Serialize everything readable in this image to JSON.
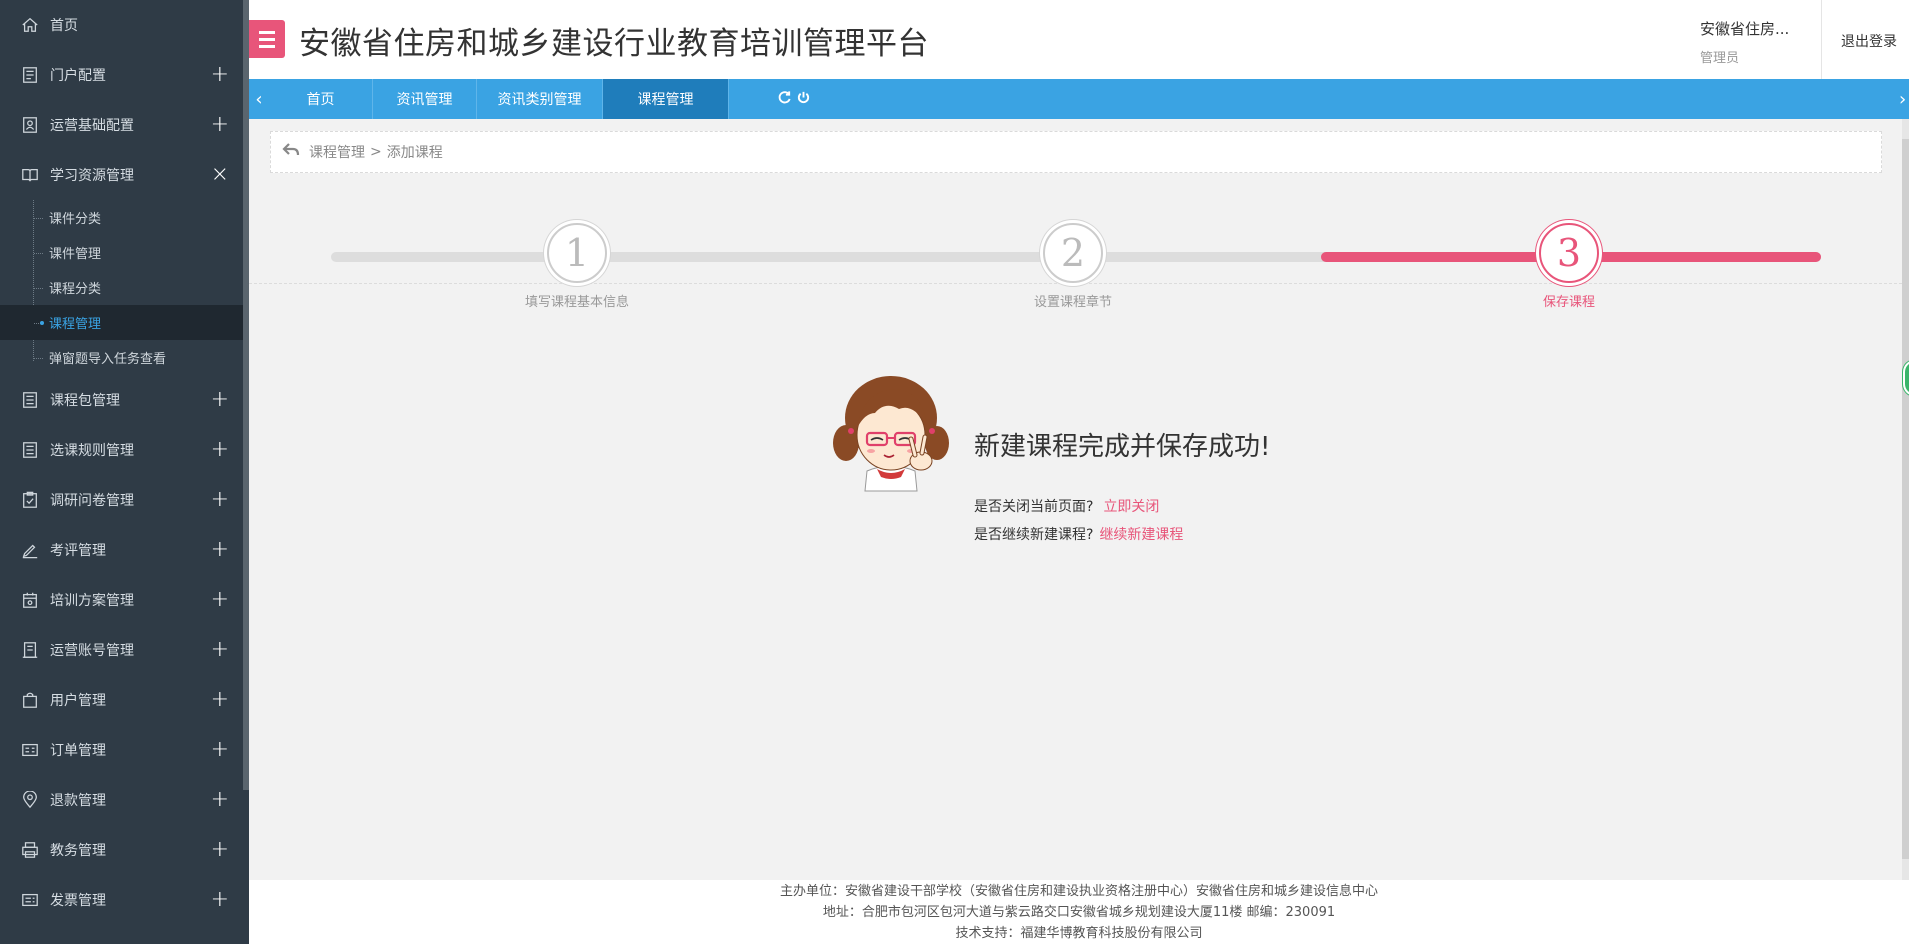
{
  "header": {
    "title": "安徽省住房和城乡建设行业教育培训管理平台",
    "user_name": "安徽省住房...",
    "user_role": "管理员",
    "logout": "退出登录"
  },
  "sidebar": {
    "items": [
      {
        "label": "首页",
        "icon": "home-icon",
        "toggle": ""
      },
      {
        "label": "门户配置",
        "icon": "document-icon",
        "toggle": "+"
      },
      {
        "label": "运营基础配置",
        "icon": "profile-card-icon",
        "toggle": "+"
      },
      {
        "label": "学习资源管理",
        "icon": "book-icon",
        "toggle": "×"
      },
      {
        "label": "课程包管理",
        "icon": "list-icon",
        "toggle": "+"
      },
      {
        "label": "选课规则管理",
        "icon": "list-icon",
        "toggle": "+"
      },
      {
        "label": "调研问卷管理",
        "icon": "clipboard-check-icon",
        "toggle": "+"
      },
      {
        "label": "考评管理",
        "icon": "pen-icon",
        "toggle": "+"
      },
      {
        "label": "培训方案管理",
        "icon": "calendar-icon",
        "toggle": "+"
      },
      {
        "label": "运营账号管理",
        "icon": "account-book-icon",
        "toggle": "+"
      },
      {
        "label": "用户管理",
        "icon": "bag-icon",
        "toggle": "+"
      },
      {
        "label": "订单管理",
        "icon": "order-card-icon",
        "toggle": "+"
      },
      {
        "label": "退款管理",
        "icon": "location-icon",
        "toggle": "+"
      },
      {
        "label": "教务管理",
        "icon": "printer-icon",
        "toggle": "+"
      },
      {
        "label": "发票管理",
        "icon": "invoice-icon",
        "toggle": "+"
      }
    ],
    "sub_items": [
      "课件分类",
      "课件管理",
      "课程分类",
      "课程管理",
      "弹窗题导入任务查看"
    ],
    "active_sub": "课程管理"
  },
  "tabs": [
    {
      "label": "首页",
      "active": false
    },
    {
      "label": "资讯管理",
      "active": false
    },
    {
      "label": "资讯类别管理",
      "active": false
    },
    {
      "label": "课程管理",
      "active": true
    }
  ],
  "breadcrumb": {
    "parent": "课程管理",
    "separator": ">",
    "current": "添加课程"
  },
  "steps": [
    {
      "number": "1",
      "label": "填写课程基本信息",
      "current": false
    },
    {
      "number": "2",
      "label": "设置课程章节",
      "current": false
    },
    {
      "number": "3",
      "label": "保存课程",
      "current": true
    }
  ],
  "success": {
    "title": "新建课程完成并保存成功!",
    "close_question": "是否关闭当前页面?",
    "close_link": "立即关闭",
    "continue_question": "是否继续新建课程?",
    "continue_link": "继续新建课程"
  },
  "footer": {
    "line1": "主办单位：安徽省建设干部学校（安徽省住房和建设执业资格注册中心）安徽省住房和城乡建设信息中心",
    "line2": "地址：合肥市包河区包河大道与紫云路交口安徽省城乡规划建设大厦11楼 邮编：230091",
    "line3": "技术支持：福建华博教育科技股份有限公司"
  },
  "colors": {
    "accent_pink": "#e8557a",
    "tab_blue": "#3aa3e3",
    "sidebar_bg": "#2f3b46"
  }
}
